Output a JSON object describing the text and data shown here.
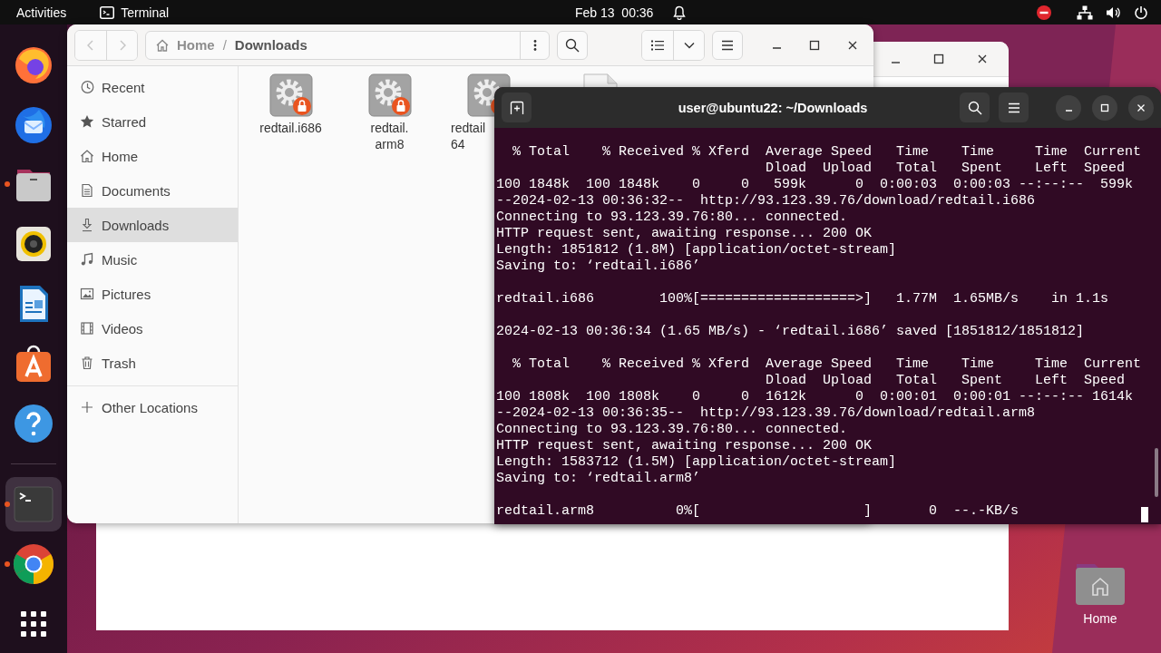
{
  "top_bar": {
    "activities": "Activities",
    "app_name": "Terminal",
    "clock": "Feb 13  00:36"
  },
  "dock": [
    {
      "kind": "firefox",
      "running": false,
      "selected": false
    },
    {
      "kind": "thunderbird",
      "running": false,
      "selected": false
    },
    {
      "kind": "files",
      "running": true,
      "selected": false
    },
    {
      "kind": "rhythmbox",
      "running": false,
      "selected": false
    },
    {
      "kind": "writer",
      "running": false,
      "selected": false
    },
    {
      "kind": "appcenter",
      "running": false,
      "selected": false
    },
    {
      "kind": "help",
      "running": false,
      "selected": false
    },
    {
      "kind": "terminal",
      "running": true,
      "selected": true
    },
    {
      "kind": "chrome",
      "running": true,
      "selected": false
    },
    {
      "kind": "appgrid",
      "running": false,
      "selected": false
    }
  ],
  "desktop_icons": [
    {
      "label": "Home"
    }
  ],
  "file_manager": {
    "back": {
      "disabled": true
    },
    "forward": {
      "disabled": true
    },
    "path_separator": "/",
    "path": [
      {
        "label": "Home",
        "selected": false
      },
      {
        "label": "Downloads",
        "selected": true
      }
    ],
    "sidebar": [
      {
        "label": "Recent",
        "kind": "recent",
        "selected": false
      },
      {
        "label": "Starred",
        "kind": "starred",
        "selected": false
      },
      {
        "label": "Home",
        "kind": "home",
        "selected": false
      },
      {
        "label": "Documents",
        "kind": "documents",
        "selected": false
      },
      {
        "label": "Downloads",
        "kind": "downloads",
        "selected": true
      },
      {
        "label": "Music",
        "kind": "music",
        "selected": false
      },
      {
        "label": "Pictures",
        "kind": "pictures",
        "selected": false
      },
      {
        "label": "Videos",
        "kind": "videos",
        "selected": false
      },
      {
        "label": "Trash",
        "kind": "trash",
        "selected": false
      }
    ],
    "other_locations": {
      "label": "Other Locations",
      "selected": false
    },
    "files": [
      {
        "kind": "executable",
        "name_lines": [
          "redtail.i686"
        ]
      },
      {
        "kind": "executable",
        "name_lines": [
          "redtail.",
          "arm8"
        ]
      },
      {
        "kind": "executable",
        "name_lines": [
          "redtail",
          "64"
        ]
      },
      {
        "kind": "document"
      }
    ]
  },
  "terminal": {
    "title": "user@ubuntu22: ~/Downloads",
    "blocks": [
      [
        "  % Total    % Received % Xferd  Average Speed   Time    Time     Time  Current",
        "                                 Dload  Upload   Total   Spent    Left  Speed",
        "100 1848k  100 1848k    0     0   599k      0  0:00:03  0:00:03 --:--:--  599k",
        "--2024-02-13 00:36:32--  http://93.123.39.76/download/redtail.i686",
        "Connecting to 93.123.39.76:80... connected.",
        "HTTP request sent, awaiting response... 200 OK",
        "Length: 1851812 (1.8M) [application/octet-stream]",
        "Saving to: ‘redtail.i686’"
      ],
      [
        "redtail.i686        100%[===================>]   1.77M  1.65MB/s    in 1.1s"
      ],
      [
        "2024-02-13 00:36:34 (1.65 MB/s) - ‘redtail.i686’ saved [1851812/1851812]"
      ],
      [
        "  % Total    % Received % Xferd  Average Speed   Time    Time     Time  Current",
        "                                 Dload  Upload   Total   Spent    Left  Speed",
        "100 1808k  100 1808k    0     0  1612k      0  0:00:01  0:00:01 --:--:-- 1614k",
        "--2024-02-13 00:36:35--  http://93.123.39.76/download/redtail.arm8",
        "Connecting to 93.123.39.76:80... connected.",
        "HTTP request sent, awaiting response... 200 OK",
        "Length: 1583712 (1.5M) [application/octet-stream]",
        "Saving to: ‘redtail.arm8’"
      ],
      [
        "redtail.arm8          0%[                    ]       0  --.-KB/s"
      ]
    ]
  }
}
